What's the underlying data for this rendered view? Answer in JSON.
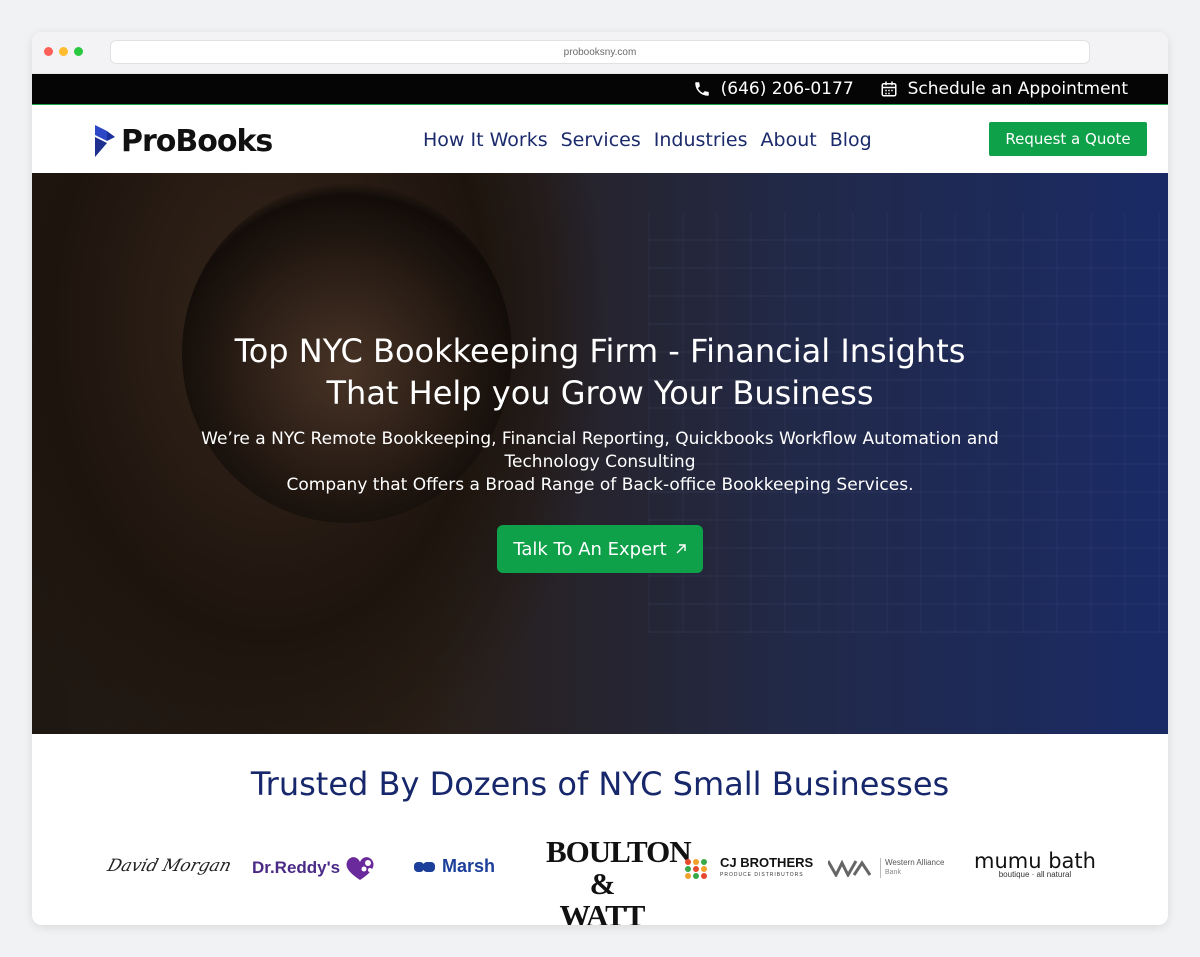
{
  "browser": {
    "url": "probooksny.com"
  },
  "topbar": {
    "phone": "(646) 206-0177",
    "appointment": "Schedule an Appointment"
  },
  "nav": {
    "logo": "ProBooks",
    "links": [
      "How It Works",
      "Services",
      "Industries",
      "About",
      "Blog"
    ],
    "quote_button": "Request a Quote"
  },
  "hero": {
    "title_line1": "Top NYC Bookkeeping Firm - Financial Insights",
    "title_line2": "That Help you Grow Your Business",
    "sub_line1": "We’re a NYC Remote Bookkeeping, Financial Reporting,  Quickbooks Workflow Automation and",
    "sub_line2": "Technology Consulting",
    "sub_line3": "Company that Offers a Broad Range of Back-office Bookkeeping Services.",
    "cta": "Talk To An Expert"
  },
  "trusted": {
    "heading": "Trusted By Dozens of NYC Small Businesses",
    "logos": [
      "David Morgan",
      "Dr.Reddy's",
      "Marsh",
      "BOULTON & WATT",
      "CJ BROTHERS",
      "PRODUCE DISTRIBUTORS",
      "Western Alliance",
      "Bank",
      "mumu bath",
      "boutique · all natural"
    ]
  },
  "colors": {
    "accent_green": "#0fa14a",
    "nav_blue": "#1b2a6b",
    "heading_blue": "#17276b"
  }
}
